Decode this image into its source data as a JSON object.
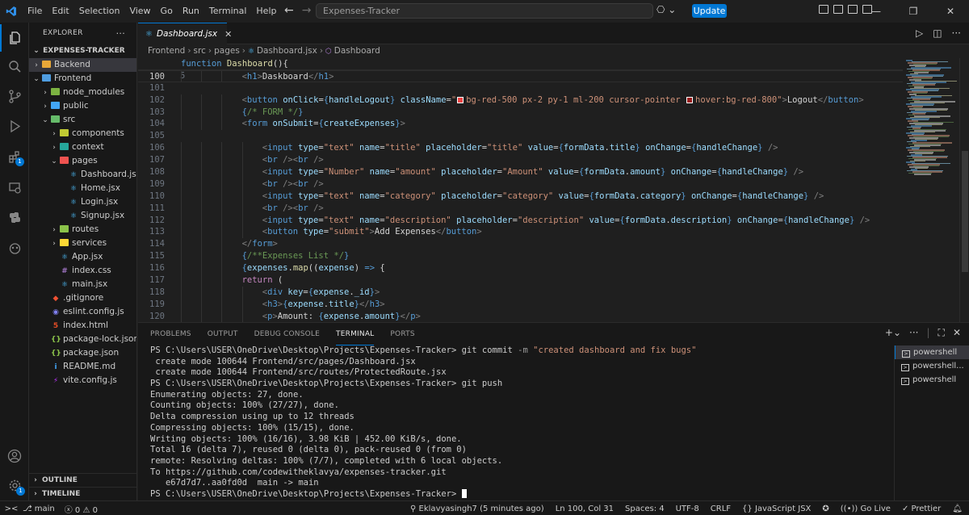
{
  "menu": [
    "File",
    "Edit",
    "Selection",
    "View",
    "Go",
    "Run",
    "Terminal",
    "Help"
  ],
  "search": {
    "value": "Expenses-Tracker"
  },
  "update_label": "Update",
  "explorer": {
    "header": "EXPLORER",
    "project": "EXPENSES-TRACKER",
    "items": [
      {
        "label": "Backend",
        "depth": 0,
        "kind": "folder",
        "chev": "closed",
        "color": "#e8a838",
        "selected": true
      },
      {
        "label": "Frontend",
        "depth": 0,
        "kind": "folder",
        "chev": "open",
        "color": "#4f9de0"
      },
      {
        "label": "node_modules",
        "depth": 1,
        "kind": "folder",
        "chev": "closed",
        "color": "#7cb342"
      },
      {
        "label": "public",
        "depth": 1,
        "kind": "folder",
        "chev": "closed",
        "color": "#42a5f5"
      },
      {
        "label": "src",
        "depth": 1,
        "kind": "folder",
        "chev": "open",
        "color": "#66bb6a"
      },
      {
        "label": "components",
        "depth": 2,
        "kind": "folder",
        "chev": "closed",
        "color": "#c0ca33"
      },
      {
        "label": "context",
        "depth": 2,
        "kind": "folder",
        "chev": "closed",
        "color": "#26a69a"
      },
      {
        "label": "pages",
        "depth": 2,
        "kind": "folder",
        "chev": "open",
        "color": "#ef5350"
      },
      {
        "label": "Dashboard.jsx",
        "depth": 3,
        "kind": "react"
      },
      {
        "label": "Home.jsx",
        "depth": 3,
        "kind": "react"
      },
      {
        "label": "Login.jsx",
        "depth": 3,
        "kind": "react"
      },
      {
        "label": "Signup.jsx",
        "depth": 3,
        "kind": "react"
      },
      {
        "label": "routes",
        "depth": 2,
        "kind": "folder",
        "chev": "closed",
        "color": "#8bc34a"
      },
      {
        "label": "services",
        "depth": 2,
        "kind": "folder",
        "chev": "closed",
        "color": "#fdd835"
      },
      {
        "label": "App.jsx",
        "depth": 2,
        "kind": "react"
      },
      {
        "label": "index.css",
        "depth": 2,
        "kind": "css"
      },
      {
        "label": "main.jsx",
        "depth": 2,
        "kind": "react"
      },
      {
        "label": ".gitignore",
        "depth": 1,
        "kind": "git"
      },
      {
        "label": "eslint.config.js",
        "depth": 1,
        "kind": "eslint"
      },
      {
        "label": "index.html",
        "depth": 1,
        "kind": "html"
      },
      {
        "label": "package-lock.json",
        "depth": 1,
        "kind": "npm"
      },
      {
        "label": "package.json",
        "depth": 1,
        "kind": "npm"
      },
      {
        "label": "README.md",
        "depth": 1,
        "kind": "info"
      },
      {
        "label": "vite.config.js",
        "depth": 1,
        "kind": "vite"
      }
    ],
    "outline": "OUTLINE",
    "timeline": "TIMELINE"
  },
  "tab": {
    "label": "Dashboard.jsx"
  },
  "breadcrumb": [
    "Frontend",
    "src",
    "pages",
    "Dashboard.jsx",
    "Dashboard"
  ],
  "editor": {
    "sticky": {
      "num": "5",
      "text": "function Dashboard(){"
    },
    "current_line": "100",
    "lines": [
      {
        "num": "100",
        "indent": 6,
        "html": "<span class='punc'>&lt;</span><span class='tag'>h1</span><span class='punc'>&gt;</span><span class='txt'>Daskboard</span><span class='punc'>&lt;/</span><span class='tag'>h1</span><span class='punc'>&gt;</span>"
      },
      {
        "num": "101",
        "indent": 0,
        "html": ""
      },
      {
        "num": "102",
        "indent": 6,
        "html": "<span class='punc'>&lt;</span><span class='tag'>button</span> <span class='attr'>onClick</span><span class='txt'>=</span><span class='brc'>{</span><span class='var'>handleLogout</span><span class='brc'>}</span> <span class='attr'>className</span><span class='txt'>=</span><span class='str'>\"<span class='sw' style='background:#ef4444'></span>bg-red-500 px-2 py-1 ml-200 cursor-pointer <span class='sw' style='background:#991b1b'></span>hover:bg-red-800\"</span><span class='punc'>&gt;</span><span class='txt'>Logout</span><span class='punc'>&lt;/</span><span class='tag'>button</span><span class='punc'>&gt;</span>"
      },
      {
        "num": "103",
        "indent": 6,
        "html": "<span class='brc'>{</span><span class='com'>/* FORM */</span><span class='brc'>}</span>"
      },
      {
        "num": "104",
        "indent": 6,
        "html": "<span class='punc'>&lt;</span><span class='tag'>form</span> <span class='attr'>onSubmit</span><span class='txt'>=</span><span class='brc'>{</span><span class='var'>createExpenses</span><span class='brc'>}</span><span class='punc'>&gt;</span>"
      },
      {
        "num": "105",
        "indent": 0,
        "html": ""
      },
      {
        "num": "106",
        "indent": 8,
        "html": "<span class='punc'>&lt;</span><span class='tag'>input</span> <span class='attr'>type</span><span class='txt'>=</span><span class='str'>\"text\"</span> <span class='attr'>name</span><span class='txt'>=</span><span class='str'>\"title\"</span> <span class='attr'>placeholder</span><span class='txt'>=</span><span class='str'>\"title\"</span> <span class='attr'>value</span><span class='txt'>=</span><span class='brc'>{</span><span class='var'>formData</span><span class='txt'>.</span><span class='var'>title</span><span class='brc'>}</span> <span class='attr'>onChange</span><span class='txt'>=</span><span class='brc'>{</span><span class='var'>handleChange</span><span class='brc'>}</span> <span class='punc'>/&gt;</span>"
      },
      {
        "num": "107",
        "indent": 8,
        "html": "<span class='punc'>&lt;</span><span class='tag'>br</span> <span class='punc'>/&gt;&lt;</span><span class='tag'>br</span> <span class='punc'>/&gt;</span>"
      },
      {
        "num": "108",
        "indent": 8,
        "html": "<span class='punc'>&lt;</span><span class='tag'>input</span> <span class='attr'>type</span><span class='txt'>=</span><span class='str'>\"Number\"</span> <span class='attr'>name</span><span class='txt'>=</span><span class='str'>\"amount\"</span> <span class='attr'>placeholder</span><span class='txt'>=</span><span class='str'>\"Amount\"</span> <span class='attr'>value</span><span class='txt'>=</span><span class='brc'>{</span><span class='var'>formData</span><span class='txt'>.</span><span class='var'>amount</span><span class='brc'>}</span> <span class='attr'>onChange</span><span class='txt'>=</span><span class='brc'>{</span><span class='var'>handleChange</span><span class='brc'>}</span> <span class='punc'>/&gt;</span>"
      },
      {
        "num": "109",
        "indent": 8,
        "html": "<span class='punc'>&lt;</span><span class='tag'>br</span> <span class='punc'>/&gt;&lt;</span><span class='tag'>br</span> <span class='punc'>/&gt;</span>"
      },
      {
        "num": "110",
        "indent": 8,
        "html": "<span class='punc'>&lt;</span><span class='tag'>input</span> <span class='attr'>type</span><span class='txt'>=</span><span class='str'>\"text\"</span> <span class='attr'>name</span><span class='txt'>=</span><span class='str'>\"category\"</span> <span class='attr'>placeholder</span><span class='txt'>=</span><span class='str'>\"category\"</span> <span class='attr'>value</span><span class='txt'>=</span><span class='brc'>{</span><span class='var'>formData</span><span class='txt'>.</span><span class='var'>category</span><span class='brc'>}</span> <span class='attr'>onChange</span><span class='txt'>=</span><span class='brc'>{</span><span class='var'>handleChange</span><span class='brc'>}</span> <span class='punc'>/&gt;</span>"
      },
      {
        "num": "111",
        "indent": 8,
        "html": "<span class='punc'>&lt;</span><span class='tag'>br</span> <span class='punc'>/&gt;&lt;</span><span class='tag'>br</span> <span class='punc'>/&gt;</span>"
      },
      {
        "num": "112",
        "indent": 8,
        "html": "<span class='punc'>&lt;</span><span class='tag'>input</span> <span class='attr'>type</span><span class='txt'>=</span><span class='str'>\"text\"</span> <span class='attr'>name</span><span class='txt'>=</span><span class='str'>\"description\"</span> <span class='attr'>placeholder</span><span class='txt'>=</span><span class='str'>\"description\"</span> <span class='attr'>value</span><span class='txt'>=</span><span class='brc'>{</span><span class='var'>formData</span><span class='txt'>.</span><span class='var'>description</span><span class='brc'>}</span> <span class='attr'>onChange</span><span class='txt'>=</span><span class='brc'>{</span><span class='var'>handleChange</span><span class='brc'>}</span> <span class='punc'>/&gt;</span>"
      },
      {
        "num": "113",
        "indent": 8,
        "html": "<span class='punc'>&lt;</span><span class='tag'>button</span> <span class='attr'>type</span><span class='txt'>=</span><span class='str'>\"submit\"</span><span class='punc'>&gt;</span><span class='txt'>Add Expenses</span><span class='punc'>&lt;/</span><span class='tag'>button</span><span class='punc'>&gt;</span>"
      },
      {
        "num": "114",
        "indent": 6,
        "html": "<span class='punc'>&lt;/</span><span class='tag'>form</span><span class='punc'>&gt;</span>"
      },
      {
        "num": "115",
        "indent": 6,
        "html": "<span class='brc'>{</span><span class='com'>/**Expenses List */</span><span class='brc'>}</span>"
      },
      {
        "num": "116",
        "indent": 6,
        "html": "<span class='brc'>{</span><span class='var'>expenses</span><span class='txt'>.</span><span class='fn'>map</span><span class='txt'>((</span><span class='var'>expense</span><span class='txt'>) </span><span class='kw'>=&gt;</span><span class='txt'> {</span>"
      },
      {
        "num": "117",
        "indent": 6,
        "html": "<span class='kw2'>return</span><span class='txt'> (</span>"
      },
      {
        "num": "118",
        "indent": 8,
        "html": "<span class='punc'>&lt;</span><span class='tag'>div</span> <span class='attr'>key</span><span class='txt'>=</span><span class='brc'>{</span><span class='var'>expense</span><span class='txt'>.</span><span class='var'>_id</span><span class='brc'>}</span><span class='punc'>&gt;</span>"
      },
      {
        "num": "119",
        "indent": 8,
        "html": "<span class='punc'>&lt;</span><span class='tag'>h3</span><span class='punc'>&gt;</span><span class='brc'>{</span><span class='var'>expense</span><span class='txt'>.</span><span class='var'>title</span><span class='brc'>}</span><span class='punc'>&lt;/</span><span class='tag'>h3</span><span class='punc'>&gt;</span>"
      },
      {
        "num": "120",
        "indent": 8,
        "html": "<span class='punc'>&lt;</span><span class='tag'>p</span><span class='punc'>&gt;</span><span class='txt'>Amount: </span><span class='brc'>{</span><span class='var'>expense</span><span class='txt'>.</span><span class='var'>amount</span><span class='brc'>}</span><span class='punc'>&lt;/</span><span class='tag'>p</span><span class='punc'>&gt;</span>"
      }
    ]
  },
  "panel": {
    "tabs": [
      "PROBLEMS",
      "OUTPUT",
      "DEBUG CONSOLE",
      "TERMINAL",
      "PORTS"
    ],
    "active_tab": "TERMINAL",
    "terminals": [
      "powershell",
      "powershell...",
      "powershell"
    ]
  },
  "terminal": {
    "lines": [
      {
        "dot": "hollow",
        "parts": [
          [
            "",
            "PS C:\\Users\\USER\\OneDrive\\Desktop\\Projects\\Expenses-Tracker> git commit "
          ],
          [
            "term-flag",
            "-m"
          ],
          [
            "",
            " "
          ],
          [
            "term-str",
            "\"created dashboard and fix bugs\""
          ]
        ]
      },
      {
        "parts": [
          [
            "",
            " create mode 100644 Frontend/src/pages/Dashboard.jsx"
          ]
        ]
      },
      {
        "parts": [
          [
            "",
            " create mode 100644 Frontend/src/routes/ProtectedRoute.jsx"
          ]
        ]
      },
      {
        "dot": "blue",
        "parts": [
          [
            "",
            "PS C:\\Users\\USER\\OneDrive\\Desktop\\Projects\\Expenses-Tracker> git push"
          ]
        ]
      },
      {
        "parts": [
          [
            "",
            "Enumerating objects: 27, done."
          ]
        ]
      },
      {
        "parts": [
          [
            "",
            "Counting objects: 100% (27/27), done."
          ]
        ]
      },
      {
        "parts": [
          [
            "",
            "Delta compression using up to 12 threads"
          ]
        ]
      },
      {
        "parts": [
          [
            "",
            "Compressing objects: 100% (15/15), done."
          ]
        ]
      },
      {
        "parts": [
          [
            "",
            "Writing objects: 100% (16/16), 3.98 KiB | 452.00 KiB/s, done."
          ]
        ]
      },
      {
        "parts": [
          [
            "",
            "Total 16 (delta 7), reused 0 (delta 0), pack-reused 0 (from 0)"
          ]
        ]
      },
      {
        "parts": [
          [
            "",
            "remote: Resolving deltas: 100% (7/7), completed with 6 local objects."
          ]
        ]
      },
      {
        "parts": [
          [
            "",
            "To https://github.com/codewitheklavya/expenses-tracker.git"
          ]
        ]
      },
      {
        "parts": [
          [
            "",
            "   e67d7d7..aa0fd0d  main -> main"
          ]
        ]
      },
      {
        "dot": "hollow",
        "cursor": true,
        "parts": [
          [
            "",
            "PS C:\\Users\\USER\\OneDrive\\Desktop\\Projects\\Expenses-Tracker> "
          ]
        ]
      }
    ]
  },
  "status": {
    "branch": "main",
    "errors": "0",
    "warnings": "0",
    "blame": "Eklavyasingh7 (5 minutes ago)",
    "position": "Ln 100, Col 31",
    "spaces": "Spaces: 4",
    "encoding": "UTF-8",
    "eol": "CRLF",
    "language": "JavaScript JSX",
    "golive": "Go Live",
    "prettier": "Prettier"
  },
  "colors": {
    "accent": "#0078d4",
    "bg": "#1f1f1f",
    "sidebar_bg": "#181818"
  }
}
